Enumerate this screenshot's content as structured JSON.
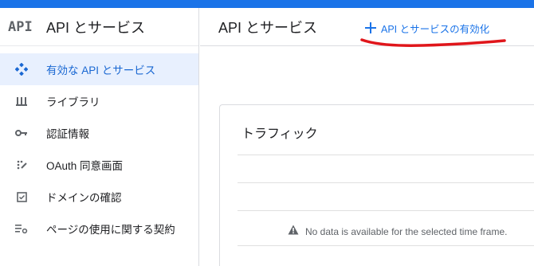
{
  "sidebar": {
    "logo": "API",
    "title": "API とサービス",
    "items": [
      {
        "label": "有効な API とサービス",
        "icon": "dashboard-diamond-icon",
        "active": true
      },
      {
        "label": "ライブラリ",
        "icon": "library-icon",
        "active": false
      },
      {
        "label": "認証情報",
        "icon": "key-icon",
        "active": false
      },
      {
        "label": "OAuth 同意画面",
        "icon": "oauth-consent-icon",
        "active": false
      },
      {
        "label": "ドメインの確認",
        "icon": "checkbox-icon",
        "active": false
      },
      {
        "label": "ページの使用に関する契約",
        "icon": "settings-list-icon",
        "active": false
      }
    ]
  },
  "header": {
    "title": "API とサービス",
    "enable_button": {
      "icon": "plus-icon",
      "label": "API とサービスの有効化"
    }
  },
  "traffic_card": {
    "title": "トラフィック",
    "no_data_icon": "warning-icon",
    "no_data_text": "No data is available for the selected time frame."
  },
  "colors": {
    "top_bar": "#1a73e8",
    "accent": "#1a73e8",
    "active_bg": "#e8f0fe",
    "annotation": "#e0161b"
  }
}
